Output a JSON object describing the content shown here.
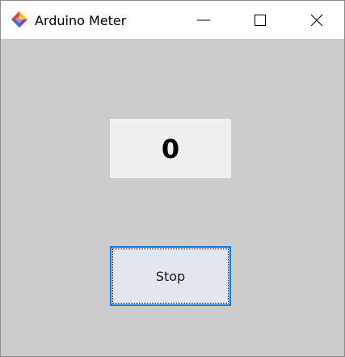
{
  "window": {
    "title": "Arduino Meter",
    "icon": "app-icon",
    "controls": {
      "minimize_icon": "minimize-icon",
      "maximize_icon": "maximize-icon",
      "close_icon": "close-icon"
    }
  },
  "main": {
    "meter_value": "0",
    "stop_button_label": "Stop"
  },
  "colors": {
    "client_background": "#cccccc",
    "display_background": "#f0f0f0",
    "button_background": "#e1e6f0",
    "button_focus_border": "#0078d7"
  }
}
